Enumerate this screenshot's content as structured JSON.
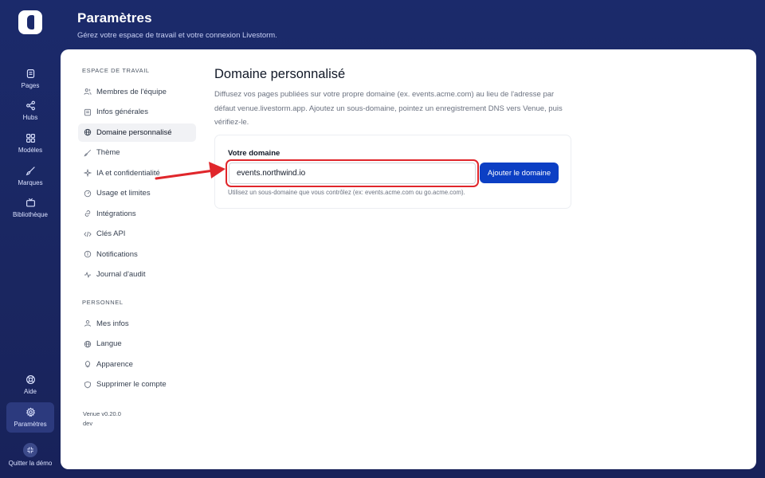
{
  "rail": {
    "items": [
      {
        "label": "Pages",
        "icon": "pages-icon"
      },
      {
        "label": "Hubs",
        "icon": "share-icon"
      },
      {
        "label": "Modèles",
        "icon": "grid-icon"
      },
      {
        "label": "Marques",
        "icon": "brush-icon"
      },
      {
        "label": "Bibliothèque",
        "icon": "tv-icon"
      }
    ],
    "bottom": [
      {
        "label": "Aide",
        "icon": "help-icon"
      },
      {
        "label": "Paramètres",
        "icon": "gear-icon"
      },
      {
        "label": "Quitter la démo",
        "icon": "exit-icon"
      }
    ]
  },
  "header": {
    "title": "Paramètres",
    "subtitle": "Gérez votre espace de travail et votre connexion Livestorm."
  },
  "nav": {
    "workspace_title": "Espace de travail",
    "workspace_items": [
      "Membres de l'équipe",
      "Infos générales",
      "Domaine personnalisé",
      "Thème",
      "IA et confidentialité",
      "Usage et limites",
      "Intégrations",
      "Clés API",
      "Notifications",
      "Journal d'audit"
    ],
    "personal_title": "Personnel",
    "personal_items": [
      "Mes infos",
      "Langue",
      "Apparence",
      "Supprimer le compte"
    ],
    "version": "Venue v0.20.0",
    "env": "dev"
  },
  "main": {
    "title": "Domaine personnalisé",
    "description": "Diffusez vos pages publiées sur votre propre domaine (ex. events.acme.com) au lieu de l'adresse par défaut venue.livestorm.app. Ajoutez un sous-domaine, pointez un enregistrement DNS vers Venue, puis vérifiez-le.",
    "field_label": "Votre domaine",
    "field_value": "events.northwind.io",
    "button_label": "Ajouter le domaine",
    "hint": "Utilisez un sous-domaine que vous contrôlez (ex: events.acme.com ou go.acme.com)."
  },
  "colors": {
    "accent": "#0c3fc4",
    "highlight": "#e0262b",
    "background": "#1b2a6b"
  }
}
